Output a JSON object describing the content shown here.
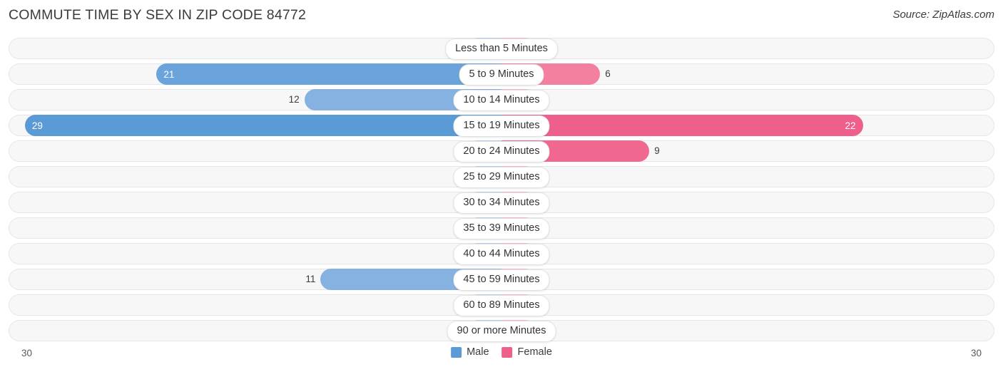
{
  "header": {
    "title": "COMMUTE TIME BY SEX IN ZIP CODE 84772",
    "source": "Source: ZipAtlas.com"
  },
  "axis": {
    "left_label": "30",
    "right_label": "30"
  },
  "legend": {
    "items": [
      {
        "label": "Male",
        "color": "#5b9bd5"
      },
      {
        "label": "Female",
        "color": "#ef5f8b"
      }
    ]
  },
  "colors": {
    "male_strong": "#5b9bd5",
    "male_mid": "#85b2e0",
    "male_light": "#aecbeb",
    "female_strong": "#ef5f8b",
    "female_mid": "#f4809f",
    "female_light": "#f9aec5",
    "track_bg": "#f7f7f7",
    "track_border": "#e6e6e6",
    "text": "#3b3b3b"
  },
  "chart_data": {
    "type": "bar",
    "title": "COMMUTE TIME BY SEX IN ZIP CODE 84772",
    "subtitle": "",
    "xlabel": "",
    "ylabel": "",
    "orientation": "horizontal-diverging",
    "xlim": [
      0,
      30
    ],
    "grid": false,
    "legend_position": "bottom-center",
    "categories": [
      "Less than 5 Minutes",
      "5 to 9 Minutes",
      "10 to 14 Minutes",
      "15 to 19 Minutes",
      "20 to 24 Minutes",
      "25 to 29 Minutes",
      "30 to 34 Minutes",
      "35 to 39 Minutes",
      "40 to 44 Minutes",
      "45 to 59 Minutes",
      "60 to 89 Minutes",
      "90 or more Minutes"
    ],
    "series": [
      {
        "name": "Male",
        "side": "left",
        "values": [
          0,
          21,
          12,
          29,
          0,
          0,
          0,
          0,
          0,
          11,
          0,
          0
        ]
      },
      {
        "name": "Female",
        "side": "right",
        "values": [
          0,
          6,
          0,
          22,
          9,
          0,
          0,
          0,
          0,
          0,
          0,
          0
        ]
      }
    ]
  },
  "rows": [
    {
      "label": "Less than 5 Minutes",
      "male": "0",
      "female": "0",
      "male_pct": 7,
      "female_pct": 7,
      "male_inside": false,
      "female_inside": false,
      "male_color": "#aecbeb",
      "female_color": "#f9aec5"
    },
    {
      "label": "5 to 9 Minutes",
      "male": "21",
      "female": "6",
      "male_pct": 70.0,
      "female_pct": 20.0,
      "male_inside": true,
      "female_inside": false,
      "male_color": "#6aa4da",
      "female_color": "#f4809f"
    },
    {
      "label": "10 to 14 Minutes",
      "male": "12",
      "female": "0",
      "male_pct": 40.0,
      "female_pct": 7,
      "male_inside": false,
      "female_inside": false,
      "male_color": "#85b2e0",
      "female_color": "#f9aec5"
    },
    {
      "label": "15 to 19 Minutes",
      "male": "29",
      "female": "22",
      "male_pct": 96.7,
      "female_pct": 73.3,
      "male_inside": true,
      "female_inside": true,
      "male_color": "#5b9bd5",
      "female_color": "#ef5f8b"
    },
    {
      "label": "20 to 24 Minutes",
      "male": "0",
      "female": "9",
      "male_pct": 7,
      "female_pct": 30.0,
      "male_inside": false,
      "female_inside": false,
      "male_color": "#aecbeb",
      "female_color": "#f0688f"
    },
    {
      "label": "25 to 29 Minutes",
      "male": "0",
      "female": "0",
      "male_pct": 7,
      "female_pct": 7,
      "male_inside": false,
      "female_inside": false,
      "male_color": "#aecbeb",
      "female_color": "#f9aec5"
    },
    {
      "label": "30 to 34 Minutes",
      "male": "0",
      "female": "0",
      "male_pct": 7,
      "female_pct": 7,
      "male_inside": false,
      "female_inside": false,
      "male_color": "#aecbeb",
      "female_color": "#f9aec5"
    },
    {
      "label": "35 to 39 Minutes",
      "male": "0",
      "female": "0",
      "male_pct": 7,
      "female_pct": 7,
      "male_inside": false,
      "female_inside": false,
      "male_color": "#aecbeb",
      "female_color": "#f9aec5"
    },
    {
      "label": "40 to 44 Minutes",
      "male": "0",
      "female": "0",
      "male_pct": 7,
      "female_pct": 7,
      "male_inside": false,
      "female_inside": false,
      "male_color": "#aecbeb",
      "female_color": "#f9aec5"
    },
    {
      "label": "45 to 59 Minutes",
      "male": "11",
      "female": "0",
      "male_pct": 36.7,
      "female_pct": 7,
      "male_inside": false,
      "female_inside": false,
      "male_color": "#85b2e0",
      "female_color": "#f9aec5"
    },
    {
      "label": "60 to 89 Minutes",
      "male": "0",
      "female": "0",
      "male_pct": 7,
      "female_pct": 7,
      "male_inside": false,
      "female_inside": false,
      "male_color": "#aecbeb",
      "female_color": "#f9aec5"
    },
    {
      "label": "90 or more Minutes",
      "male": "0",
      "female": "0",
      "male_pct": 7,
      "female_pct": 7,
      "male_inside": false,
      "female_inside": false,
      "male_color": "#aecbeb",
      "female_color": "#f9aec5"
    }
  ]
}
